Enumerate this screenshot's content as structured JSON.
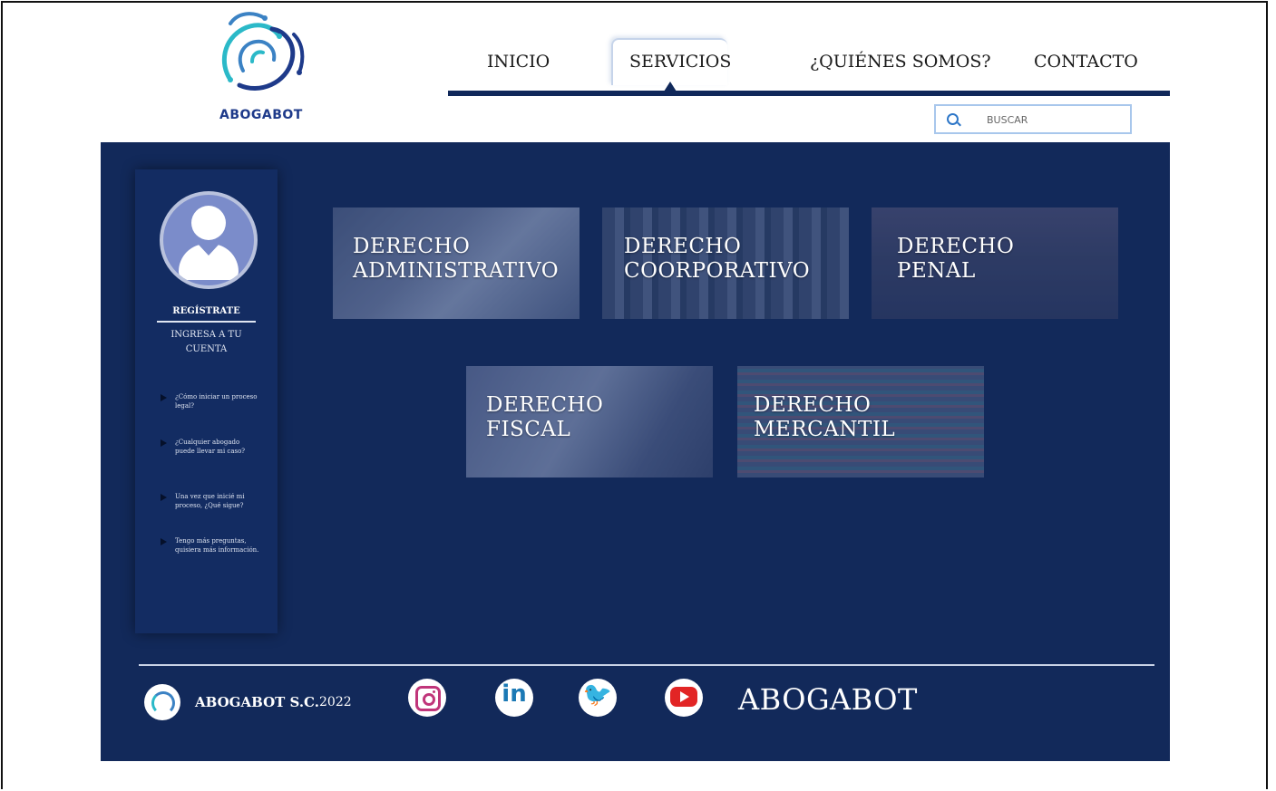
{
  "header": {
    "logo_text": "ABOGABOT",
    "nav": [
      "INICIO",
      "SERVICIOS",
      "¿QUIÉNES SOMOS?",
      "CONTACTO"
    ],
    "active_nav": "SERVICIOS",
    "search": {
      "placeholder": "BUSCAR",
      "value": ""
    }
  },
  "sidebar": {
    "register_label": "REGÍSTRATE",
    "login_label": "INGRESA A TU CUENTA",
    "faqs": [
      "¿Cómo iniciar un proceso legal?",
      "¿Cualquier abogado puede llevar mi caso?",
      "Una vez que inicié mi proceso, ¿Qué sigue?",
      "Tengo más preguntas, quisiera más información."
    ]
  },
  "services": [
    {
      "line1": "DERECHO",
      "line2": "ADMINISTRATIVO"
    },
    {
      "line1": "DERECHO",
      "line2": "COORPORATIVO"
    },
    {
      "line1": "DERECHO",
      "line2": "PENAL"
    },
    {
      "line1": "DERECHO",
      "line2": "FISCAL"
    },
    {
      "line1": "DERECHO",
      "line2": "MERCANTIL"
    }
  ],
  "footer": {
    "company": "ABOGABOT S.C.",
    "year": "2022",
    "social_icons": [
      "instagram-icon",
      "linkedin-icon",
      "twitter-icon",
      "youtube-icon"
    ],
    "brand": "ABOGABOT"
  },
  "colors": {
    "panel": "#12295a",
    "nav_line": "#10285a",
    "logo_blue": "#1e3a8a",
    "search_border": "#a8c7ec"
  }
}
